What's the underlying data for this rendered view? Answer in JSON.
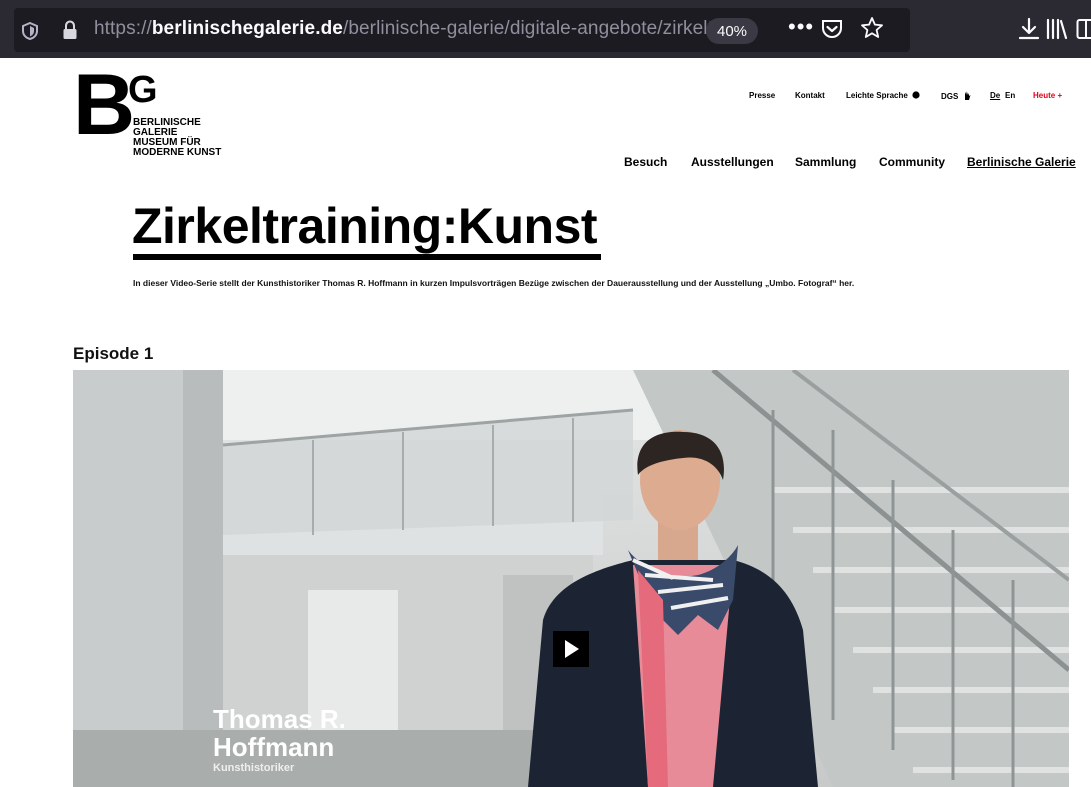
{
  "browser": {
    "url_scheme": "https://",
    "url_host": "berlinischegalerie.de",
    "url_path": "/berlinische-galerie/digitale-angebote/zirkeltrain",
    "zoom": "40%",
    "overflow_label": "•••"
  },
  "logo": {
    "letter_b": "B",
    "letter_g": "G",
    "lines": [
      "BERLINISCHE",
      "GALERIE",
      "MUSEUM FÜR",
      "MODERNE KUNST"
    ]
  },
  "utility_nav": {
    "presse": "Presse",
    "kontakt": "Kontakt",
    "leichte_sprache": "Leichte Sprache",
    "dgs": "DGS",
    "lang_de": "De",
    "lang_en": "En",
    "heute": "Heute +"
  },
  "main_nav": {
    "besuch": "Besuch",
    "ausstellungen": "Ausstellungen",
    "sammlung": "Sammlung",
    "community": "Community",
    "berlinische_galerie": "Berlinische Galerie"
  },
  "content": {
    "title": "Zirkeltraining:Kunst",
    "intro": "In dieser Video-Serie stellt der Kunsthistoriker Thomas R. Hoffmann in kurzen Impulsvorträgen Bezüge zwischen der Dauerausstellung und der Ausstellung „Umbo. Fotograf“ her.",
    "episode_heading": "Episode 1"
  },
  "video": {
    "caption_name_line1": "Thomas R.",
    "caption_name_line2": "Hoffmann",
    "caption_role": "Kunsthistoriker"
  },
  "colors": {
    "chrome_bg": "#2b2a33",
    "urlbar_bg": "#1c1b22",
    "heute_red": "#e2001a"
  }
}
